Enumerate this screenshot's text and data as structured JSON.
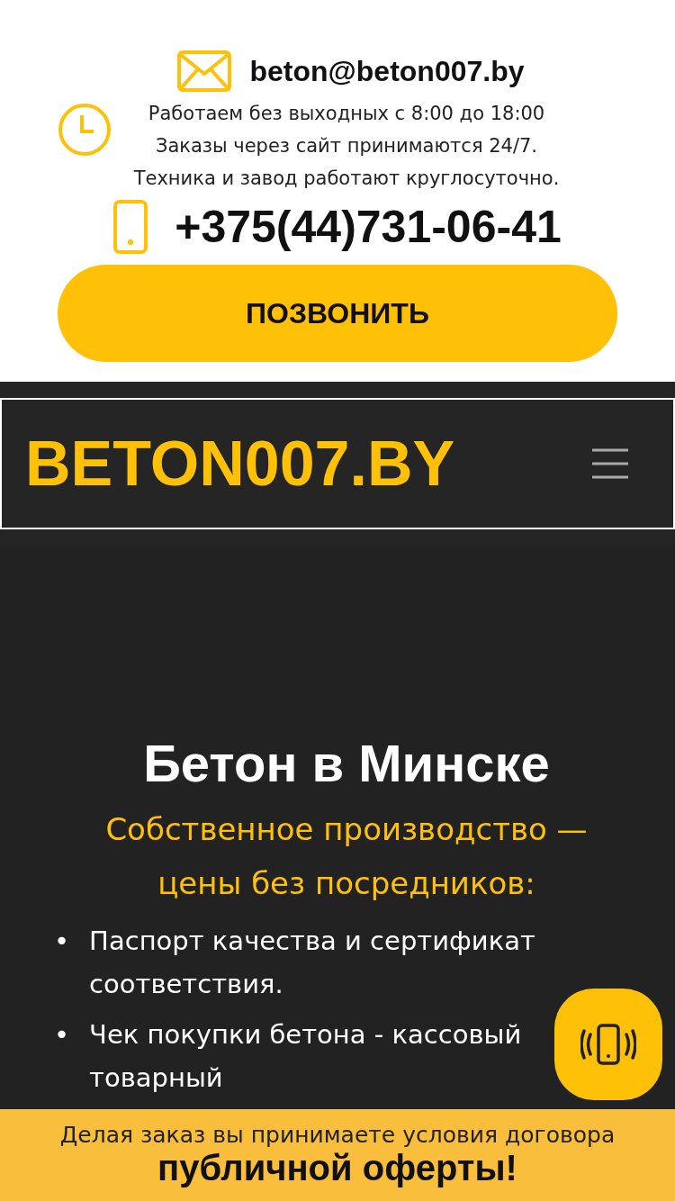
{
  "contacts": {
    "email": "beton@beton007.by",
    "hours": [
      "Работаем без выходных с 8:00 до 18:00",
      "Заказы через сайт принимаются 24/7.",
      "Техника и завод работают круглосуточно."
    ],
    "phone": "+375(44)731-06-41",
    "call_button": "ПОЗВОНИТЬ"
  },
  "header": {
    "logo": "BETON007.BY"
  },
  "hero": {
    "title": "Бетон в Минске",
    "subtitle": "Собственное производство — цены без посредников:",
    "bullets": [
      {
        "marker": "•",
        "lines": [
          "Паспорт качества и сертификат соответствия."
        ]
      },
      {
        "marker": "•",
        "lines": [
          "Чек покупки бетона - кассовый",
          "товарный"
        ]
      }
    ]
  },
  "banner": {
    "text": "Делая заказ вы принимаете условия договора",
    "link": "публичной оферты!"
  }
}
